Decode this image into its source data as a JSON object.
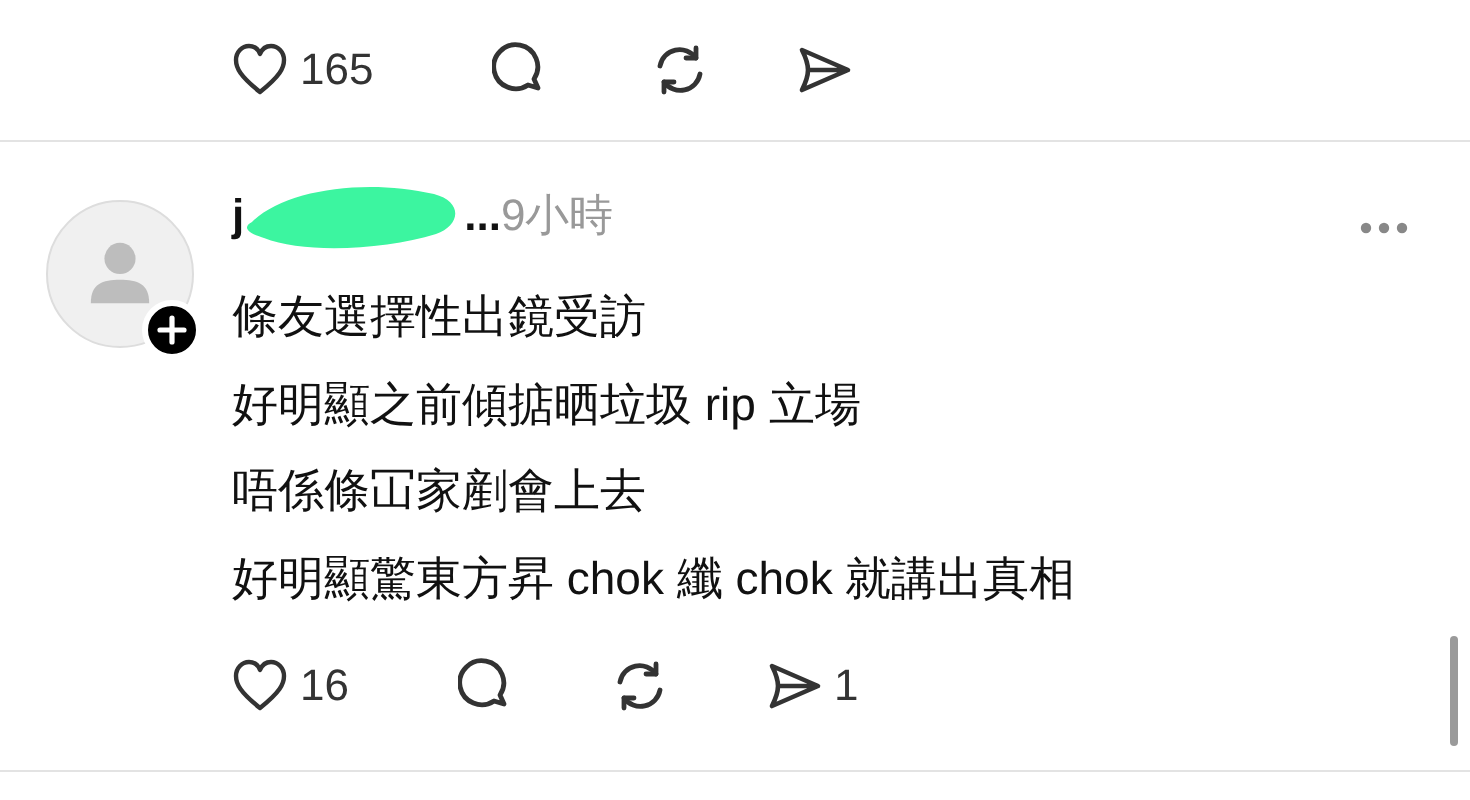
{
  "previous_post": {
    "actions": {
      "likes": "165"
    }
  },
  "reply": {
    "author_visible_start": "j",
    "author_visible_end": "...",
    "time": "9小時",
    "lines": [
      "條友選擇性出鏡受訪",
      "好明顯之前傾掂晒垃圾 rip 立場",
      "唔係條冚家剷會上去",
      "好明顯驚東方昇 chok 纖 chok 就講出真相"
    ],
    "actions": {
      "likes": "16",
      "shares": "1"
    }
  }
}
